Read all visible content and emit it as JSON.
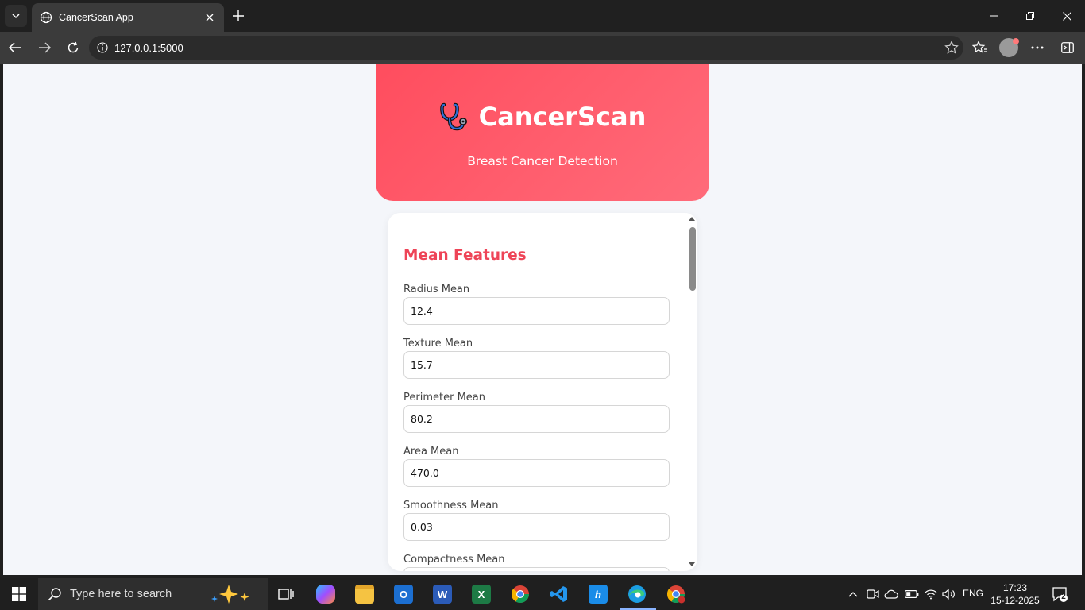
{
  "browser": {
    "tab_title": "CancerScan App",
    "url": "127.0.0.1:5000"
  },
  "page": {
    "brand_title": "CancerScan",
    "brand_icon": "stethoscope-icon",
    "subtitle": "Breast Cancer Detection",
    "section_title": "Mean Features",
    "fields": [
      {
        "label": "Radius Mean",
        "value": "12.4"
      },
      {
        "label": "Texture Mean",
        "value": "15.7"
      },
      {
        "label": "Perimeter Mean",
        "value": "80.2"
      },
      {
        "label": "Area Mean",
        "value": "470.0"
      },
      {
        "label": "Smoothness Mean",
        "value": "0.03"
      },
      {
        "label": "Compactness Mean",
        "value": ""
      }
    ]
  },
  "taskbar": {
    "search_placeholder": "Type here to search",
    "language": "ENG",
    "time": "17:23",
    "date": "15-12-2025",
    "notification_count": "2"
  },
  "colors": {
    "accent": "#ee4457",
    "hero_start": "#ff4d5e",
    "hero_end": "#ff6b7a"
  }
}
